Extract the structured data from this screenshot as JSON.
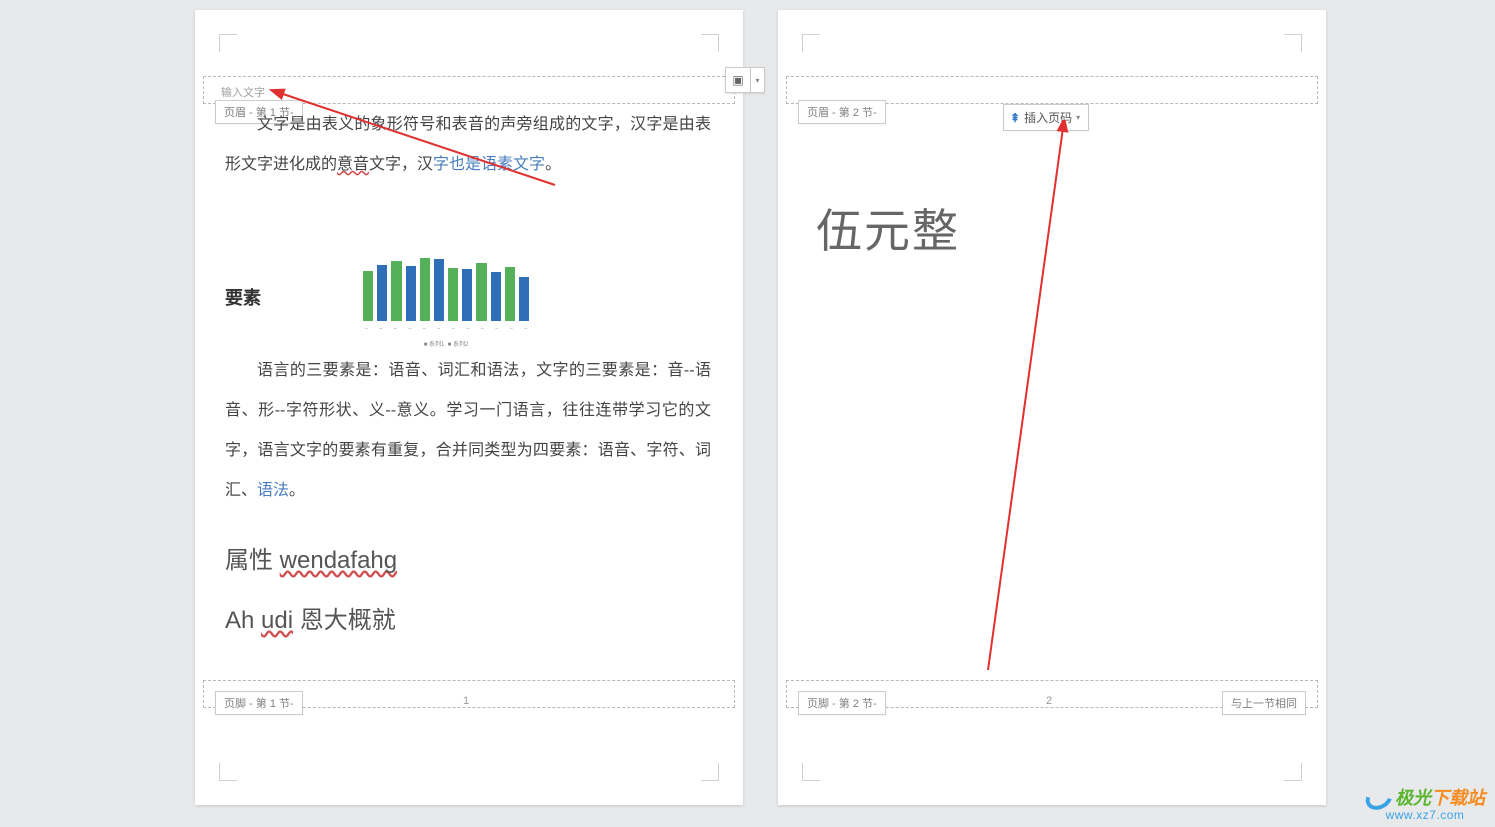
{
  "placeholder": "输入文字",
  "tags": {
    "header_s1": "页眉 - 第 1 节-",
    "footer_s1": "页脚 - 第 1 节-",
    "header_s2": "页眉 - 第 2 节-",
    "footer_s2": "页脚 - 第 2 节-",
    "same_as_prev": "与上一节相同"
  },
  "page1": {
    "para1_a": "文字是由表义的象形符号和表音的声旁组成的文字，汉字是由表形文字进化成的",
    "para1_squig": "意音",
    "para1_b": "文字，汉",
    "para1_link": "字也是语素文字",
    "para1_c": "。",
    "elements_title": "要素",
    "para2_a": "语言的三要素是：语音、词汇和语法，文字的三要素是：音--语音、形--字符形状、义--意义。学习一门语言，往往连带学习它的文字，语言文字的要素有重复，合并同类型为四要素：语音、字符、词汇、",
    "para2_link": "语法",
    "para2_b": "。",
    "sub1_a": "属性 ",
    "sub1_b": "wendafahg",
    "sub2_a": "Ah ",
    "sub2_b": "udi",
    "sub2_c": " 恩大概就",
    "page_number": "1"
  },
  "page2": {
    "big_text": "伍元整",
    "page_number": "2"
  },
  "insert_page_number_btn": "插入页码",
  "float_btn_icon": "▣",
  "logo": {
    "text": "极光下载站",
    "url": "www.xz7.com"
  },
  "chart_data": {
    "type": "bar",
    "categories": [
      "c1",
      "c2",
      "c3",
      "c4",
      "c5",
      "c6",
      "c7",
      "c8",
      "c9",
      "c10",
      "c11",
      "c12"
    ],
    "series": [
      {
        "name": "系列1",
        "values": [
          52,
          58,
          62,
          57,
          65,
          64,
          55,
          54,
          60,
          50,
          56,
          45
        ],
        "color": "#55b05a"
      },
      {
        "name": "系列2",
        "values": [
          52,
          58,
          62,
          57,
          65,
          64,
          55,
          54,
          60,
          50,
          56,
          45
        ],
        "color": "#2e6fb7"
      }
    ],
    "ylim": [
      0,
      70
    ]
  }
}
